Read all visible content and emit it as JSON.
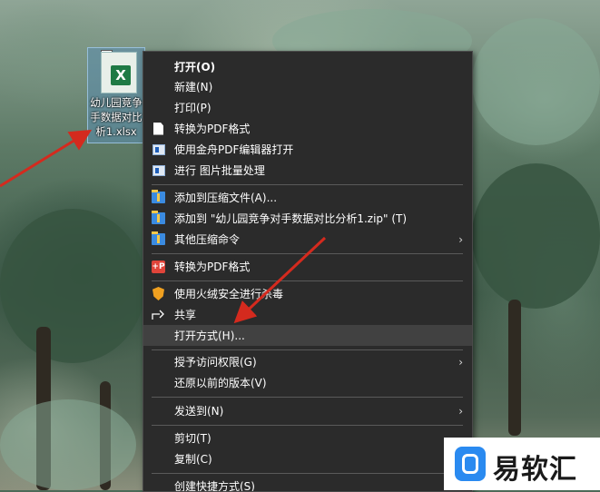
{
  "desktop": {
    "file": {
      "name": "幼儿园竞争手数据对比析1.xlsx",
      "name_lines": [
        "幼儿园竞争",
        "手数据对比",
        "析1.xlsx"
      ],
      "icon": "excel-icon",
      "icon_letter": "X",
      "check": "✓"
    }
  },
  "context_menu": {
    "items": [
      {
        "label": "打开(O)",
        "icon": null,
        "bold": true
      },
      {
        "label": "新建(N)",
        "icon": null
      },
      {
        "label": "打印(P)",
        "icon": null
      },
      {
        "label": "转换为PDF格式",
        "icon": "document-icon"
      },
      {
        "label": "使用金舟PDF编辑器打开",
        "icon": "pdf-editor-icon"
      },
      {
        "label": "进行 图片批量处理",
        "icon": "image-batch-icon"
      },
      {
        "label": "添加到压缩文件(A)...",
        "icon": "archive-icon"
      },
      {
        "label": "添加到 \"幼儿园竞争对手数据对比分析1.zip\" (T)",
        "icon": "archive-icon"
      },
      {
        "label": "其他压缩命令",
        "icon": "archive-icon",
        "submenu": true
      },
      {
        "label": "转换为PDF格式",
        "icon": "pdf-convert-icon",
        "icon_text": "+P"
      },
      {
        "label": "使用火绒安全进行杀毒",
        "icon": "shield-icon"
      },
      {
        "label": "共享",
        "icon": "share-icon"
      },
      {
        "label": "打开方式(H)...",
        "icon": null,
        "highlighted": true
      },
      {
        "label": "授予访问权限(G)",
        "icon": null,
        "submenu": true
      },
      {
        "label": "还原以前的版本(V)",
        "icon": null
      },
      {
        "label": "发送到(N)",
        "icon": null,
        "submenu": true
      },
      {
        "label": "剪切(T)",
        "icon": null
      },
      {
        "label": "复制(C)",
        "icon": null
      },
      {
        "label": "创建快捷方式(S)",
        "icon": null
      }
    ],
    "submenu_glyph": "›"
  },
  "watermark": {
    "text": "易软汇",
    "color": "#2a8af0"
  },
  "annotation_color": "#d42a1e"
}
